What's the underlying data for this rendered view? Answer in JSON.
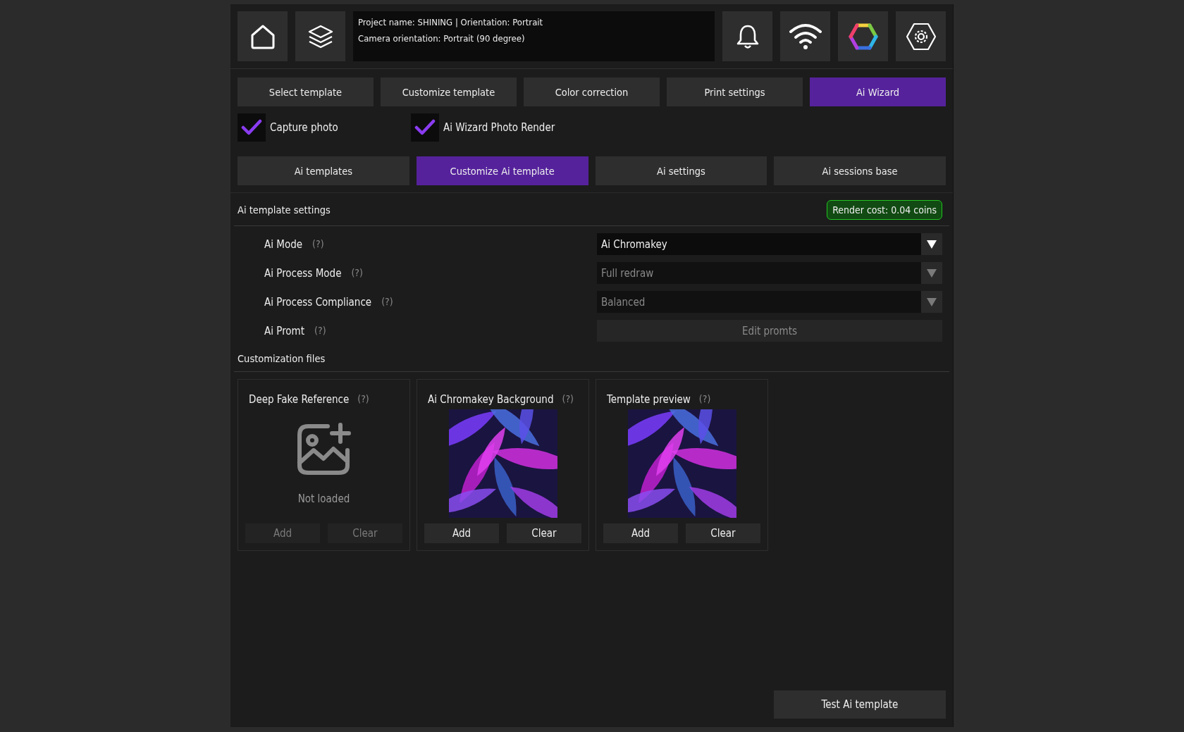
{
  "header": {
    "info_lines": [
      "Project name: SHINING | Orientation: Portrait",
      "Camera orientation: Portrait (90 degree)"
    ]
  },
  "main_tabs": [
    {
      "label": "Select template",
      "selected": false
    },
    {
      "label": "Customize template",
      "selected": false
    },
    {
      "label": "Color correction",
      "selected": false
    },
    {
      "label": "Print settings",
      "selected": false
    },
    {
      "label": "Ai Wizard",
      "selected": true
    }
  ],
  "options": [
    {
      "label": "Capture photo",
      "checked": true
    },
    {
      "label": "Ai Wizard Photo Render",
      "checked": true
    }
  ],
  "sub_tabs": [
    {
      "label": "Ai templates",
      "selected": false
    },
    {
      "label": "Customize Ai template",
      "selected": true
    },
    {
      "label": "Ai settings",
      "selected": false
    },
    {
      "label": "Ai sessions base",
      "selected": false
    }
  ],
  "template_settings": {
    "title": "Ai template settings",
    "render_cost": "Render cost: 0.04 coins",
    "rows": [
      {
        "label": "Ai Mode",
        "help": "(?)",
        "kind": "dropdown",
        "value": "Ai Chromakey",
        "disabled": false
      },
      {
        "label": "Ai Process Mode",
        "help": "(?)",
        "kind": "dropdown",
        "value": "Full redraw",
        "disabled": true
      },
      {
        "label": "Ai Process Compliance",
        "help": "(?)",
        "kind": "dropdown",
        "value": "Balanced",
        "disabled": true
      },
      {
        "label": "Ai Promt",
        "help": "(?)",
        "kind": "button",
        "value": "Edit promts",
        "disabled": true
      }
    ]
  },
  "files": {
    "title": "Customization files",
    "cards": [
      {
        "title": "Deep Fake Reference",
        "help": "(?)",
        "loaded": false,
        "status": "Not loaded",
        "buttons": [
          {
            "label": "Add",
            "disabled": true
          },
          {
            "label": "Clear",
            "disabled": true
          }
        ]
      },
      {
        "title": "Ai Chromakey Background",
        "help": "(?)",
        "loaded": true,
        "buttons": [
          {
            "label": "Add",
            "disabled": false
          },
          {
            "label": "Clear",
            "disabled": false
          }
        ]
      },
      {
        "title": "Template preview",
        "help": "(?)",
        "loaded": true,
        "buttons": [
          {
            "label": "Add",
            "disabled": false
          },
          {
            "label": "Clear",
            "disabled": false
          }
        ]
      }
    ]
  },
  "test_button": "Test Ai template"
}
